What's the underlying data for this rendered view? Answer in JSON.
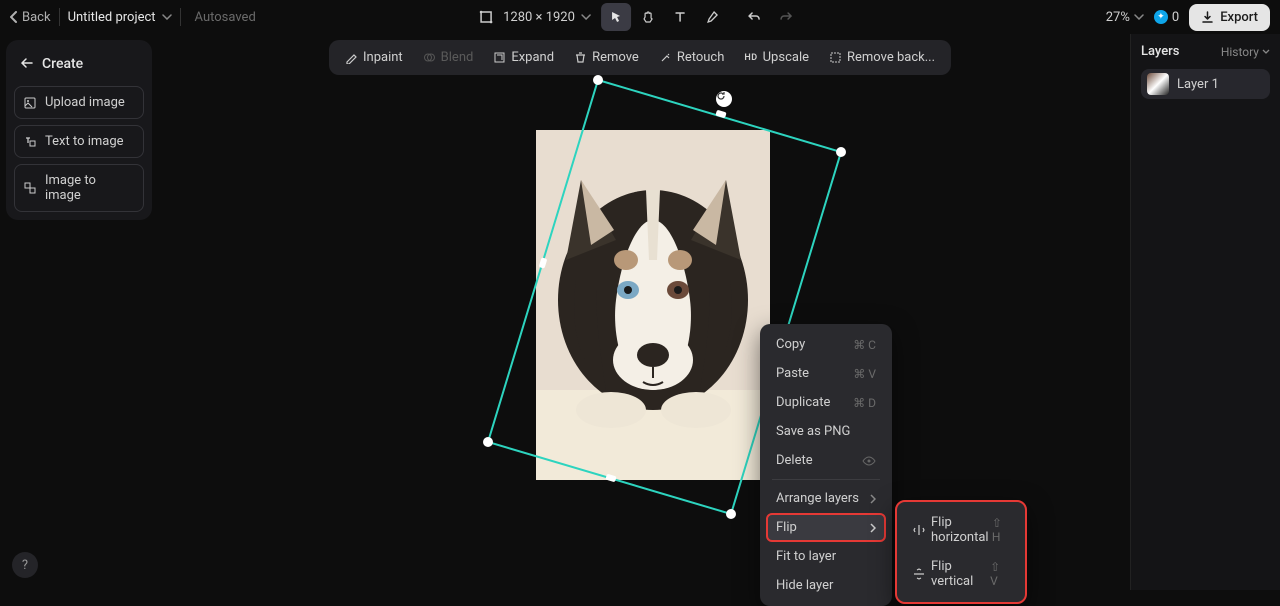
{
  "topbar": {
    "back": "Back",
    "project_title": "Untitled project",
    "autosaved": "Autosaved",
    "canvas_size": "1280 × 1920",
    "zoom": "27%",
    "credits": "0",
    "export": "Export"
  },
  "action_toolbar": {
    "inpaint": "Inpaint",
    "blend": "Blend",
    "expand": "Expand",
    "remove": "Remove",
    "retouch": "Retouch",
    "upscale": "Upscale",
    "remove_bg": "Remove back..."
  },
  "left_sidebar": {
    "create": "Create",
    "upload": "Upload image",
    "text_to_image": "Text to image",
    "image_to_image": "Image to image"
  },
  "right_panel": {
    "layers": "Layers",
    "history": "History",
    "layer1": "Layer 1"
  },
  "context_menu": {
    "copy": "Copy",
    "copy_sc": "⌘ C",
    "paste": "Paste",
    "paste_sc": "⌘ V",
    "duplicate": "Duplicate",
    "duplicate_sc": "⌘ D",
    "save_png": "Save as PNG",
    "delete": "Delete",
    "arrange": "Arrange layers",
    "flip": "Flip",
    "fit": "Fit to layer",
    "hide": "Hide layer"
  },
  "submenu": {
    "flip_h": "Flip horizontal",
    "flip_h_sc": "⇧ H",
    "flip_v": "Flip vertical",
    "flip_v_sc": "⇧ V"
  }
}
